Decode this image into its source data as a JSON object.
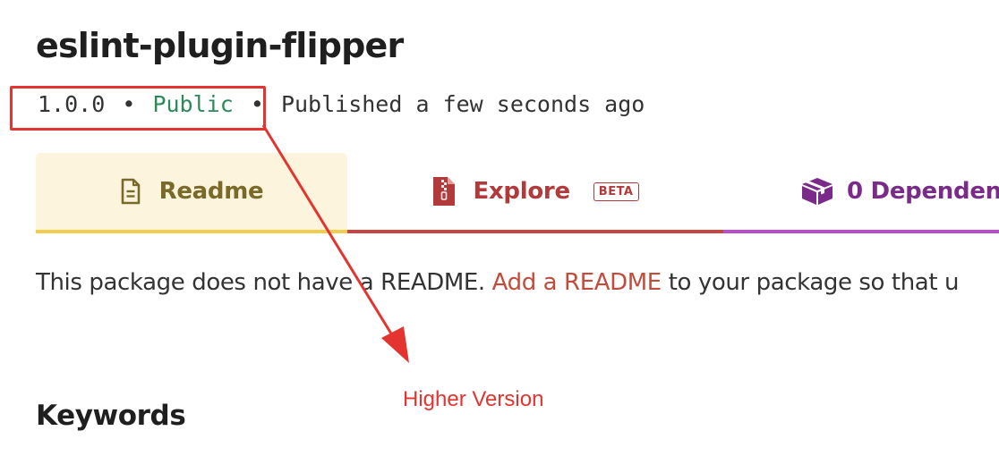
{
  "package": {
    "name": "eslint-plugin-flipper",
    "version": "1.0.0",
    "separator": "•",
    "visibility": "Public",
    "published": "Published a few seconds ago"
  },
  "tabs": [
    {
      "label": "Readme",
      "icon": "document-icon",
      "color": "#7a6a2a",
      "underline": "#f5cd4e",
      "active": true
    },
    {
      "label": "Explore",
      "icon": "zip-archive-icon",
      "badge": "BETA",
      "color": "#b23a3a",
      "underline": "#c94545",
      "active": false
    },
    {
      "label": "0 Dependen",
      "icon": "box-icon",
      "color": "#7a2b8a",
      "underline": "#b84ec9",
      "active": false
    }
  ],
  "readme_note": {
    "before": "This package does not have",
    "middle": " a README. ",
    "link": "Add a README",
    "after": " to your package so that u"
  },
  "sections": {
    "keywords": "Keywords"
  },
  "annotation": {
    "label": "Higher Version",
    "color": "#e3342f"
  }
}
